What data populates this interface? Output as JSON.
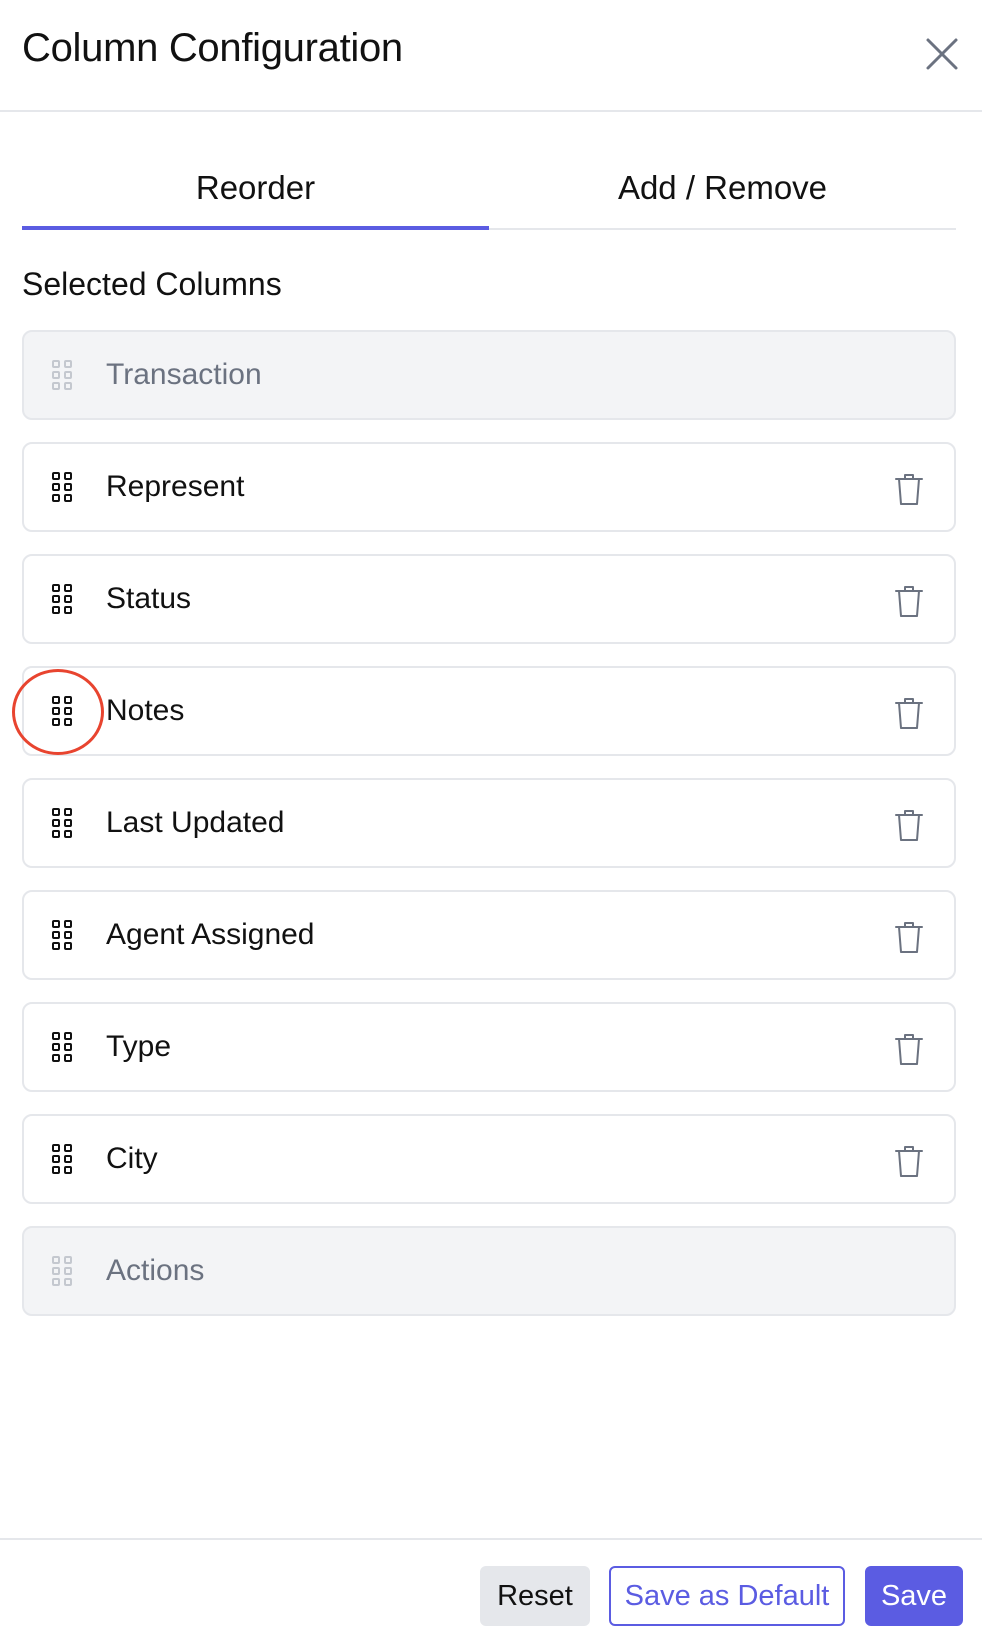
{
  "header": {
    "title": "Column Configuration"
  },
  "tabs": [
    {
      "label": "Reorder",
      "active": true
    },
    {
      "label": "Add / Remove",
      "active": false
    }
  ],
  "section": {
    "title": "Selected Columns"
  },
  "columns": [
    {
      "label": "Transaction",
      "locked": true
    },
    {
      "label": "Represent",
      "locked": false
    },
    {
      "label": "Status",
      "locked": false
    },
    {
      "label": "Notes",
      "locked": false
    },
    {
      "label": "Last Updated",
      "locked": false
    },
    {
      "label": "Agent Assigned",
      "locked": false
    },
    {
      "label": "Type",
      "locked": false
    },
    {
      "label": "City",
      "locked": false
    },
    {
      "label": "Actions",
      "locked": true
    }
  ],
  "footer": {
    "reset_label": "Reset",
    "save_default_label": "Save as Default",
    "save_label": "Save"
  },
  "colors": {
    "accent": "#5b5ce2",
    "highlight": "#e8442f",
    "locked_bg": "#f3f4f6",
    "border": "#e5e7eb"
  },
  "icons": {
    "close": "close-icon",
    "drag": "drag-handle-icon",
    "delete": "trash-icon"
  }
}
